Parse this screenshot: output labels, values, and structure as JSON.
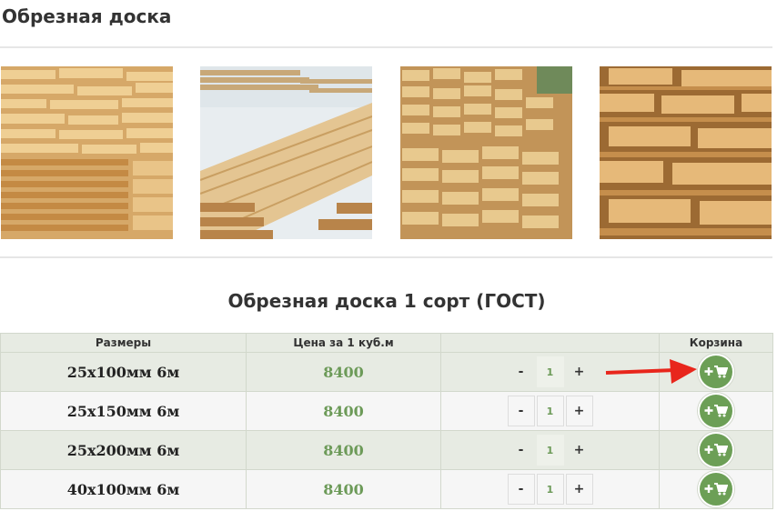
{
  "page": {
    "title": "Обрезная доска"
  },
  "section": {
    "title": "Обрезная доска 1 сорт (ГОСТ)"
  },
  "table": {
    "headers": [
      "Размеры",
      "Цена за 1 куб.м",
      "",
      "Корзина"
    ],
    "rows": [
      {
        "size": "25х100мм 6м",
        "price": "8400",
        "qty": "1"
      },
      {
        "size": "25х150мм 6м",
        "price": "8400",
        "qty": "1"
      },
      {
        "size": "25х200мм 6м",
        "price": "8400",
        "qty": "1"
      },
      {
        "size": "40х100мм 6м",
        "price": "8400",
        "qty": "1"
      }
    ],
    "minus_label": "-",
    "plus_label": "+"
  },
  "colors": {
    "accent_green": "#6c9f56",
    "price_green": "#6c9a58",
    "arrow_red": "#e8261c"
  },
  "icons": [
    "add-to-cart-icon",
    "red-arrow"
  ]
}
